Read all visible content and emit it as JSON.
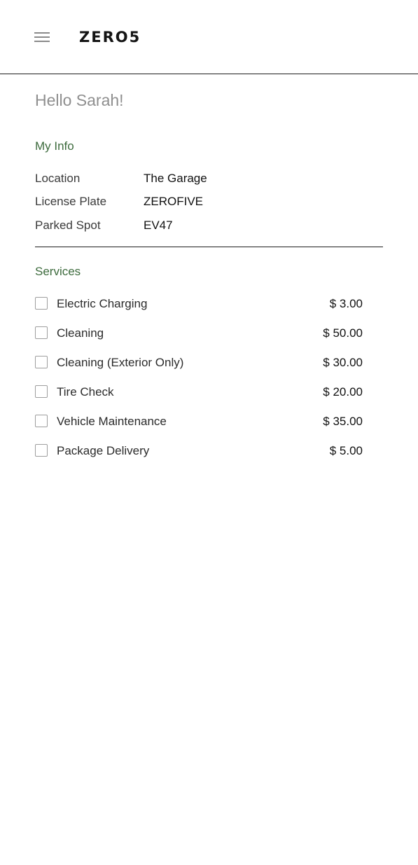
{
  "header": {
    "brand": "ZERO5",
    "menu_icon": "hamburger-menu-icon"
  },
  "greeting": "Hello Sarah!",
  "my_info": {
    "title": "My Info",
    "rows": [
      {
        "label": "Location",
        "value": "The Garage"
      },
      {
        "label": "License Plate",
        "value": "ZEROFIVE"
      },
      {
        "label": "Parked Spot",
        "value": "EV47"
      }
    ]
  },
  "services": {
    "title": "Services",
    "items": [
      {
        "label": "Electric Charging",
        "price": "$ 3.00",
        "checked": false
      },
      {
        "label": "Cleaning",
        "price": "$ 50.00",
        "checked": false
      },
      {
        "label": "Cleaning (Exterior Only)",
        "price": "$ 30.00",
        "checked": false
      },
      {
        "label": "Tire Check",
        "price": "$ 20.00",
        "checked": false
      },
      {
        "label": "Vehicle Maintenance",
        "price": "$ 35.00",
        "checked": false
      },
      {
        "label": "Package Delivery",
        "price": "$ 5.00",
        "checked": false
      }
    ]
  },
  "colors": {
    "accent": "#3d6b3d",
    "greeting": "#8f8f8f",
    "divider": "#1f1f1f"
  }
}
